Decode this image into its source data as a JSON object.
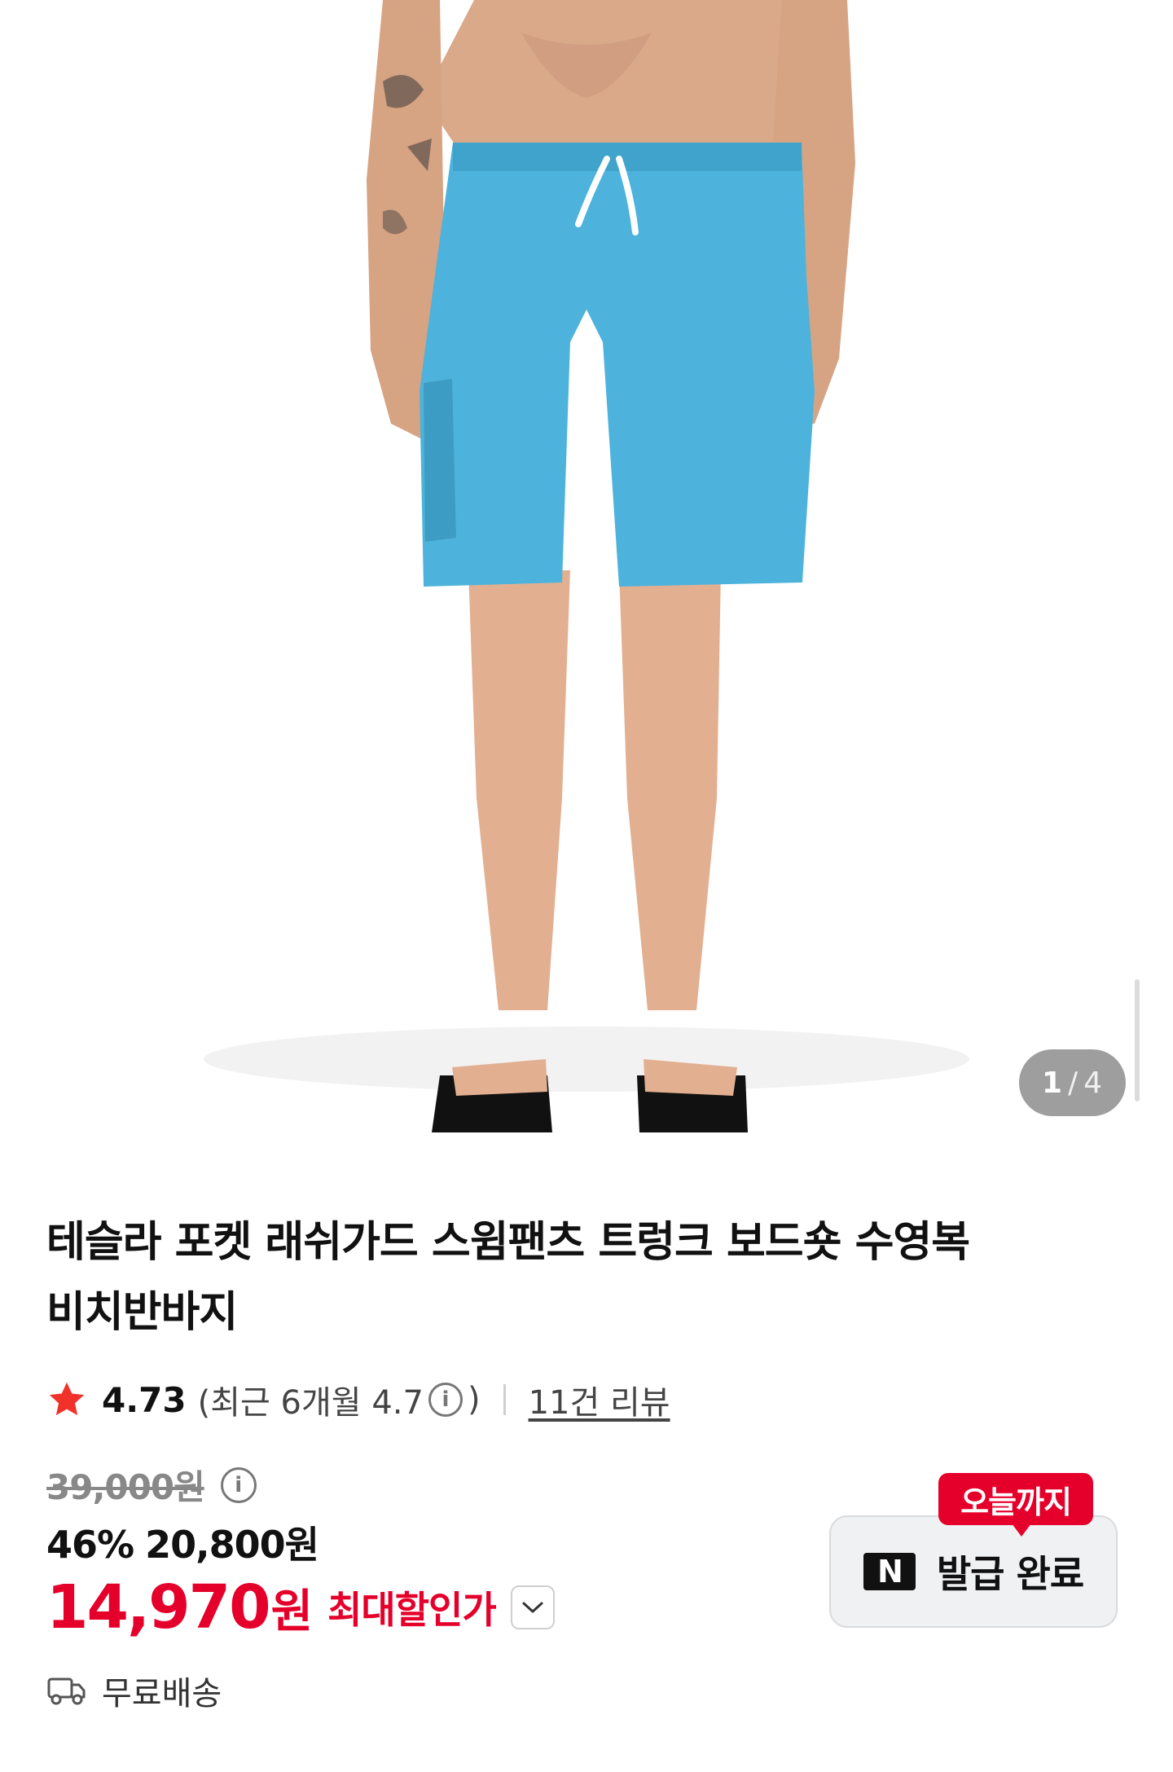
{
  "hero": {
    "image": "product-photo-blue-swim-shorts",
    "counter": {
      "current": "1",
      "separator": "/",
      "total": "4"
    }
  },
  "product": {
    "title_line1": "테슬라 포켓 래쉬가드 스윔팬츠 트렁크 보드숏 수영복",
    "title_line2": "비치반바지"
  },
  "rating": {
    "score": "4.73",
    "recent_label": "(최근 6개월 4.7",
    "info_glyph": "i",
    "close_paren": ")",
    "review_link": "11건 리뷰",
    "star_color": "#f0322a"
  },
  "price": {
    "original": "39,000원",
    "info_glyph": "i",
    "discount_rate": "46%",
    "sale_price": "20,800원",
    "max_price": "14,970",
    "max_price_unit": "원",
    "max_label": "최대할인가",
    "accent_color": "#e5002b"
  },
  "coupon": {
    "badge": "오늘까지",
    "logo": "N",
    "status": "발급 완료"
  },
  "shipping": {
    "icon": "truck-icon",
    "label": "무료배송"
  }
}
